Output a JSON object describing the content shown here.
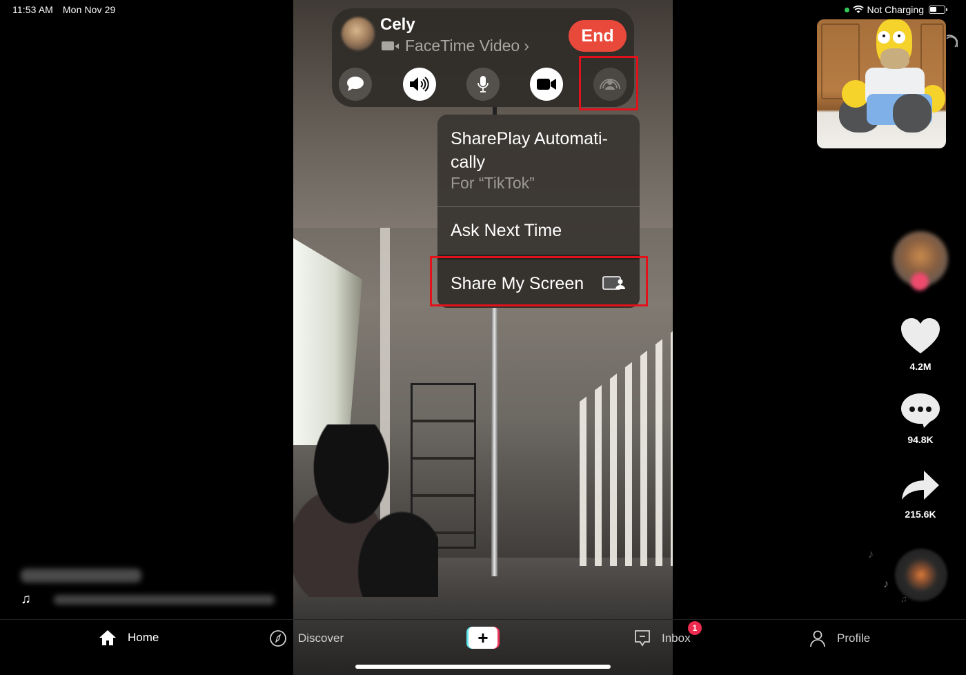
{
  "status_bar": {
    "time": "11:53 AM",
    "date": "Mon Nov 29",
    "charging_status": "Not Charging",
    "icons": [
      "camera-in-use-dot",
      "wifi-icon",
      "battery-icon"
    ]
  },
  "facetime": {
    "contact_name": "Cely",
    "call_type": "FaceTime Video",
    "call_type_chevron": "›",
    "end_label": "End",
    "controls": [
      {
        "name": "messages",
        "icon": "message-bubble-icon"
      },
      {
        "name": "speaker",
        "icon": "speaker-icon"
      },
      {
        "name": "mute",
        "icon": "microphone-icon"
      },
      {
        "name": "camera",
        "icon": "video-camera-icon"
      },
      {
        "name": "shareplay",
        "icon": "shareplay-icon"
      }
    ]
  },
  "shareplay_menu": {
    "items": [
      {
        "title": "SharePlay Automatically",
        "title_line1": "SharePlay Automati-",
        "title_line2": "cally",
        "subtitle": "For “TikTok”"
      },
      {
        "title": "Ask Next Time"
      },
      {
        "title": "Share My Screen",
        "icon": "screen-share-icon"
      }
    ]
  },
  "tiktok": {
    "actions": [
      {
        "name": "like",
        "icon": "heart-icon",
        "count": "4.2M"
      },
      {
        "name": "comment",
        "icon": "comment-icon",
        "count": "94.8K"
      },
      {
        "name": "share",
        "icon": "share-arrow-icon",
        "count": "215.6K"
      }
    ],
    "tabs": [
      {
        "label": "Home",
        "icon": "home-icon",
        "active": true
      },
      {
        "label": "Discover",
        "icon": "compass-icon",
        "active": false
      },
      {
        "label": "+",
        "icon": "create-icon"
      },
      {
        "label": "Inbox",
        "icon": "inbox-icon",
        "active": false,
        "badge": "1"
      },
      {
        "label": "Profile",
        "icon": "profile-icon",
        "active": false
      }
    ]
  },
  "colors": {
    "end_button": "#e9493b",
    "highlight": "#e2111a",
    "badge": "#ee2a4f",
    "tiktok_cyan": "#5fe3ea",
    "tiktok_pink": "#f0365a"
  }
}
